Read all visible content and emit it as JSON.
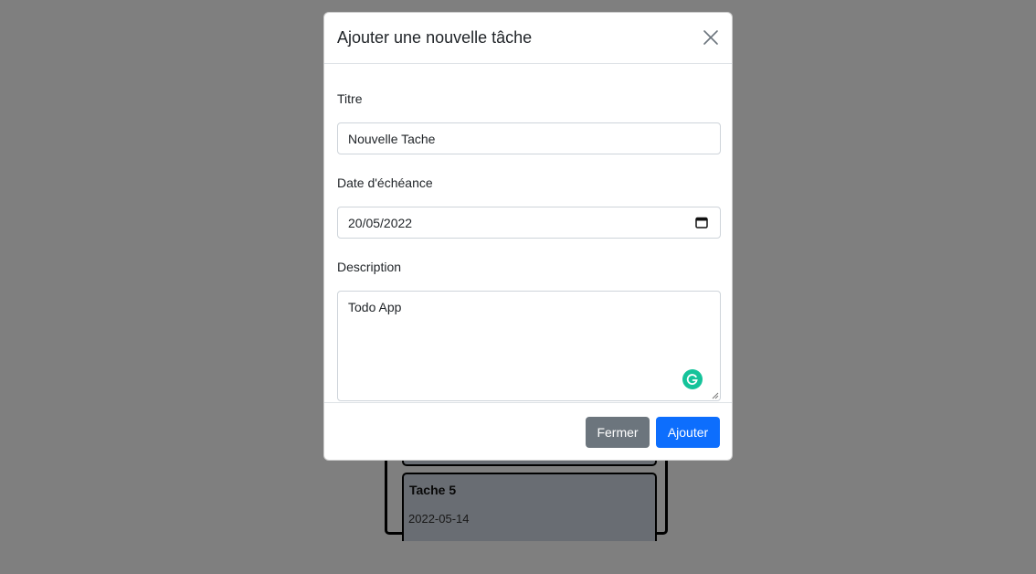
{
  "background": {
    "tasks": [
      {
        "title": "",
        "date": ""
      },
      {
        "title": "Tache 5",
        "date": "2022-05-14"
      }
    ]
  },
  "modal": {
    "title": "Ajouter une nouvelle tâche",
    "close_icon": "close-icon",
    "fields": {
      "title_label": "Titre",
      "title_value": "Nouvelle Tache",
      "date_label": "Date d'échéance",
      "date_value": "20/05/2022",
      "description_label": "Description",
      "description_value": "Todo App"
    },
    "buttons": {
      "close_label": "Fermer",
      "add_label": "Ajouter"
    }
  },
  "colors": {
    "primary": "#0d6efd",
    "secondary": "#6c757d",
    "grammarly": "#15c39a",
    "backdrop": "rgba(0,0,0,0.5)"
  }
}
